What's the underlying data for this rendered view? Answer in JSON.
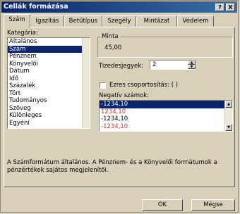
{
  "window": {
    "title": "Cellák formázása",
    "help_btn": "?",
    "close_btn": "X"
  },
  "tabs": [
    "Szám",
    "Igazítás",
    "Betűtípus",
    "Szegély",
    "Mintázat",
    "Védelem"
  ],
  "category": {
    "label": "Kategória:",
    "items": [
      "Általános",
      "Szám",
      "Pénznem",
      "Könyvelői",
      "Dátum",
      "Idő",
      "Százalék",
      "Tört",
      "Tudományos",
      "Szöveg",
      "Különleges",
      "Egyéni"
    ],
    "selected_index": 1
  },
  "sample": {
    "label": "Minta",
    "value": "45,00"
  },
  "decimals": {
    "label": "Tizedesjegyek:",
    "value": "2"
  },
  "thousands": {
    "label": "Ezres csoportosítás: ( )",
    "checked": false
  },
  "negatives": {
    "label": "Negatív számok:",
    "items": [
      {
        "text": "-1234,10",
        "color": "#ffffff"
      },
      {
        "text": "1234,10",
        "color": "#c0392b"
      },
      {
        "text": "-1234,10",
        "color": "#000000"
      },
      {
        "text": "-1234,10",
        "color": "#c0392b"
      }
    ],
    "selected_index": 0
  },
  "description": "A Számformátum általános. A Pénznem- és a Könyvelői formátumok a pénzértékek sajátos megjelenítői.",
  "buttons": {
    "ok": "OK",
    "cancel": "Mégse"
  },
  "colors": {
    "titlebar": "#0a246a",
    "selection": "#0a246a",
    "dialog_bg": "#d8d0b9"
  }
}
